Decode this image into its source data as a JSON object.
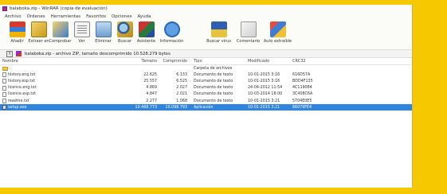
{
  "window": {
    "title": "balaboka.zip - WinRAR (copia de evaluación)"
  },
  "menu": [
    "Archivo",
    "Órdenes",
    "Herramientas",
    "Favoritos",
    "Opciones",
    "Ayuda"
  ],
  "toolbar": [
    {
      "label": "Añadir",
      "icon": "add-archive-icon"
    },
    {
      "label": "Extraer en",
      "icon": "extract-icon"
    },
    {
      "label": "Comprobar",
      "icon": "test-icon"
    },
    {
      "label": "Ver",
      "icon": "view-icon"
    },
    {
      "label": "Eliminar",
      "icon": "delete-icon"
    },
    {
      "label": "Buscar",
      "icon": "find-icon"
    },
    {
      "label": "Asistente",
      "icon": "wizard-icon"
    },
    {
      "label": "Información",
      "icon": "info-icon"
    },
    {
      "label": "Buscar virus",
      "icon": "virus-scan-icon"
    },
    {
      "label": "Comentario",
      "icon": "comment-icon"
    },
    {
      "label": "Auto extraíble",
      "icon": "sfx-icon"
    }
  ],
  "address": {
    "up_label": "↑",
    "path": "balaboka.zip - archivo ZIP, tamaño descomprimido 10.528.279 bytes"
  },
  "columns": {
    "name": "Nombre",
    "size": "Tamaño",
    "packed": "Comprimido",
    "type": "Tipo",
    "modified": "Modificado",
    "crc": "CRC32"
  },
  "files": [
    {
      "name": "..",
      "size": "",
      "packed": "",
      "type": "Carpeta de archivos",
      "modified": "",
      "crc": "",
      "kind": "folder"
    },
    {
      "name": "history.eng.txt",
      "size": "22.625",
      "packed": "6.133",
      "type": "Documento de texto",
      "modified": "10-01-2015 3:16",
      "crc": "616D57A",
      "kind": "text"
    },
    {
      "name": "history.esp.txt",
      "size": "25.557",
      "packed": "6.525",
      "type": "Documento de texto",
      "modified": "10-01-2015 3:16",
      "crc": "BDD4F135",
      "kind": "text"
    },
    {
      "name": "licence.eng.txt",
      "size": "4.869",
      "packed": "2.027",
      "type": "Documento de texto",
      "modified": "24-04-2012 11:54",
      "crc": "4C119084",
      "kind": "text"
    },
    {
      "name": "licence.esp.txt",
      "size": "4.847",
      "packed": "2.021",
      "type": "Documento de texto",
      "modified": "10-03-2014 18:00",
      "crc": "3C408C6A",
      "kind": "text"
    },
    {
      "name": "readme.txt",
      "size": "2.277",
      "packed": "1.068",
      "type": "Documento de texto",
      "modified": "10-01-2015 3:21",
      "crc": "5704E0E5",
      "kind": "text"
    },
    {
      "name": "setup.exe",
      "size": "10.468.773",
      "packed": "10.098.793",
      "type": "Aplicación",
      "modified": "10-01-2015 3:21",
      "crc": "66079FE4",
      "kind": "exe",
      "selected": true
    }
  ],
  "colors": {
    "frame": "#f5c800",
    "selection": "#2f84e0"
  }
}
